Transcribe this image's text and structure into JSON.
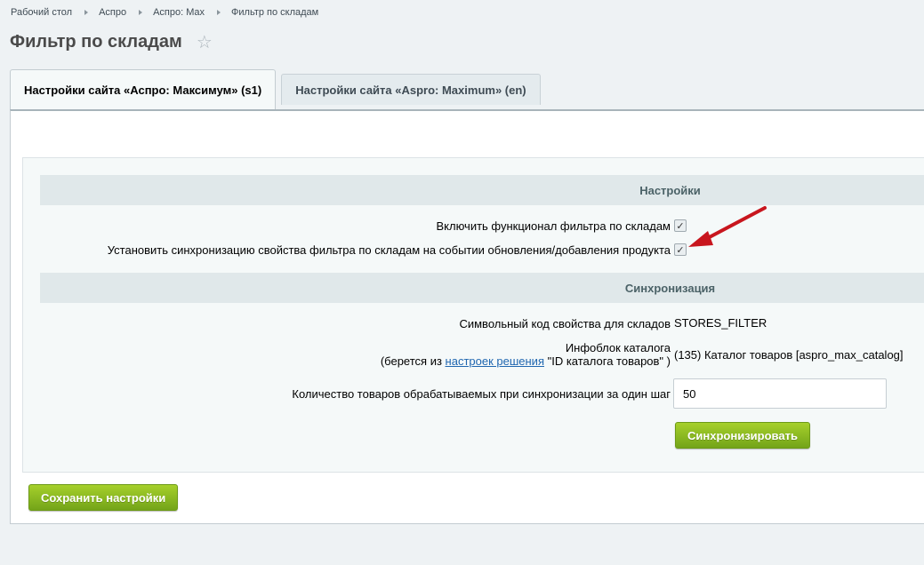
{
  "breadcrumbs": [
    "Рабочий стол",
    "Аспро",
    "Аспро: Max",
    "Фильтр по складам"
  ],
  "page_title": "Фильтр по складам",
  "tabs": [
    {
      "label": "Настройки сайта «Аспро: Максимум» (s1)",
      "active": true
    },
    {
      "label": "Настройки сайта «Aspro: Maximum» (en)",
      "active": false
    }
  ],
  "settings": {
    "section_title": "Настройки",
    "enable_filter_label": "Включить функционал фильтра по складам",
    "enable_filter_checked": true,
    "sync_event_label": "Установить синхронизацию свойства фильтра по складам на событии обновления/добавления продукта",
    "sync_event_checked": true
  },
  "sync": {
    "section_title": "Синхронизация",
    "property_code_label": "Символьный код свойства для складов",
    "property_code_value": "STORES_FILTER",
    "iblock_label_line1": "Инфоблок каталога",
    "iblock_label_prefix": "(берется из ",
    "iblock_label_link": "настроек решения",
    "iblock_label_suffix": " \"ID каталога товаров\" )",
    "iblock_value": "(135) Каталог товаров [aspro_max_catalog]",
    "qty_label": "Количество товаров обрабатываемых при синхронизации за один шаг",
    "qty_value": "50",
    "sync_button": "Синхронизировать"
  },
  "save_button": "Сохранить настройки",
  "colors": {
    "accent_green": "#7cb41d",
    "arrow_red": "#c8161e",
    "link": "#2067b0"
  }
}
